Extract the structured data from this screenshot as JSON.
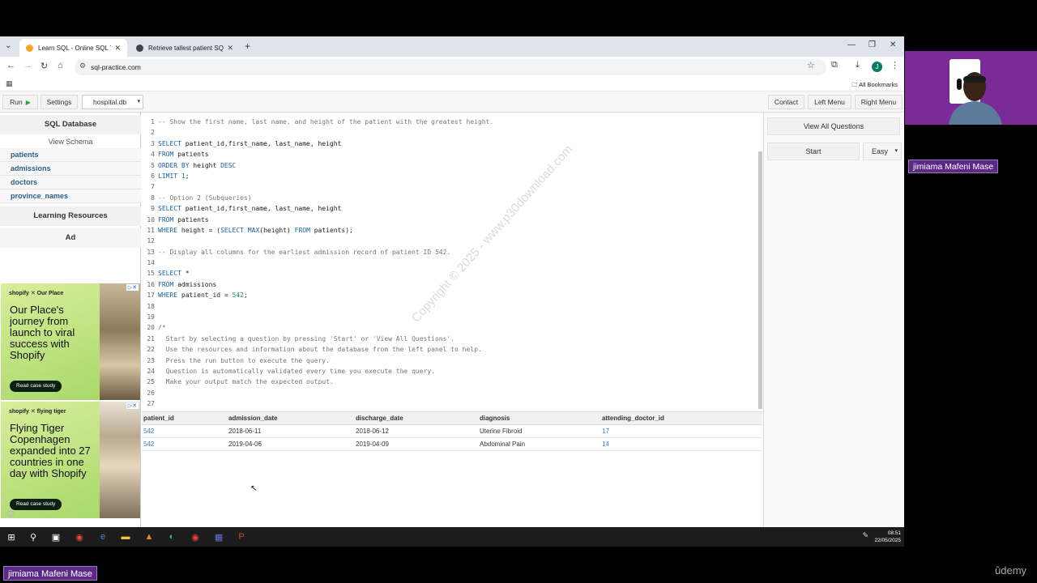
{
  "browser": {
    "tabs": [
      {
        "title": "Learn SQL - Online SQL Terminal",
        "active": true
      },
      {
        "title": "Retrieve tallest patient SQL",
        "active": false
      }
    ],
    "url": "sql-practice.com",
    "bookmarks_label": "All Bookmarks",
    "profile_initial": "J"
  },
  "toolbar": {
    "run_label": "Run",
    "settings_label": "Settings",
    "database": "hospital.db",
    "contact_label": "Contact",
    "left_menu_label": "Left Menu",
    "right_menu_label": "Right Menu"
  },
  "sidebar": {
    "title": "SQL Database",
    "view_schema": "View Schema",
    "tables": [
      "patients",
      "admissions",
      "doctors",
      "province_names"
    ],
    "learning_resources": "Learning Resources",
    "ad_label": "Ad",
    "ads": [
      {
        "brand": "shopify  ✕  Our Place",
        "headline": "Our Place's journey from launch to viral success with Shopify",
        "cta": "Read case study",
        "bg": "#b9e07a"
      },
      {
        "brand": "shopify  ✕  flying tiger",
        "headline": "Flying Tiger Copenhagen expanded into 27 countries in one day with Shopify",
        "cta": "Read case study",
        "bg": "#b9e07a"
      }
    ]
  },
  "editor": {
    "line_numbers": [
      "1",
      "2",
      "3",
      "4",
      "5",
      "6",
      "7",
      "8",
      "9",
      "10",
      "11",
      "12",
      "13",
      "14",
      "15",
      "16",
      "17",
      "18",
      "19",
      "20",
      "21",
      "22",
      "23",
      "24",
      "25",
      "26",
      "27"
    ],
    "lines": [
      "-- Show the first name, last name, and height of the patient with the greatest height.",
      "",
      "SELECT patient_id,first_name, last_name, height",
      "FROM patients",
      "ORDER BY height DESC",
      "LIMIT 1;",
      "",
      "-- Option 2 (Subqueries)",
      "SELECT patient_id,first_name, last_name, height",
      "FROM patients",
      "WHERE height = (SELECT MAX(height) FROM patients);",
      "",
      "-- Display all columns for the earliest admission record of patient ID 542.",
      "",
      "SELECT *",
      "FROM admissions",
      "WHERE patient_id = 542;",
      "",
      "",
      "/*",
      "  Start by selecting a question by pressing 'Start' or 'View All Questions'.",
      "  Use the resources and information about the database from the left panel to help.",
      "  Press the run button to execute the query.",
      "  Question is automatically validated every time you execute the query.",
      "  Make your output match the expected output.",
      "",
      ""
    ],
    "watermark": "Copyright © 2025 - www.p30download.com"
  },
  "results": {
    "columns": [
      "patient_id",
      "admission_date",
      "discharge_date",
      "diagnosis",
      "attending_doctor_id"
    ],
    "rows": [
      [
        "542",
        "2018-06-11",
        "2018-06-12",
        "Uterine Fibroid",
        "17"
      ],
      [
        "542",
        "2019-04-06",
        "2019-04-09",
        "Abdominal Pain",
        "14"
      ]
    ]
  },
  "right_panel": {
    "view_all_label": "View All Questions",
    "start_label": "Start",
    "difficulty": "Easy"
  },
  "taskbar": {
    "time": "08:51",
    "date": "22/05/2025"
  },
  "overlay": {
    "presenter_name": "jimiama Mafeni Mase",
    "platform": "ûdemy"
  }
}
